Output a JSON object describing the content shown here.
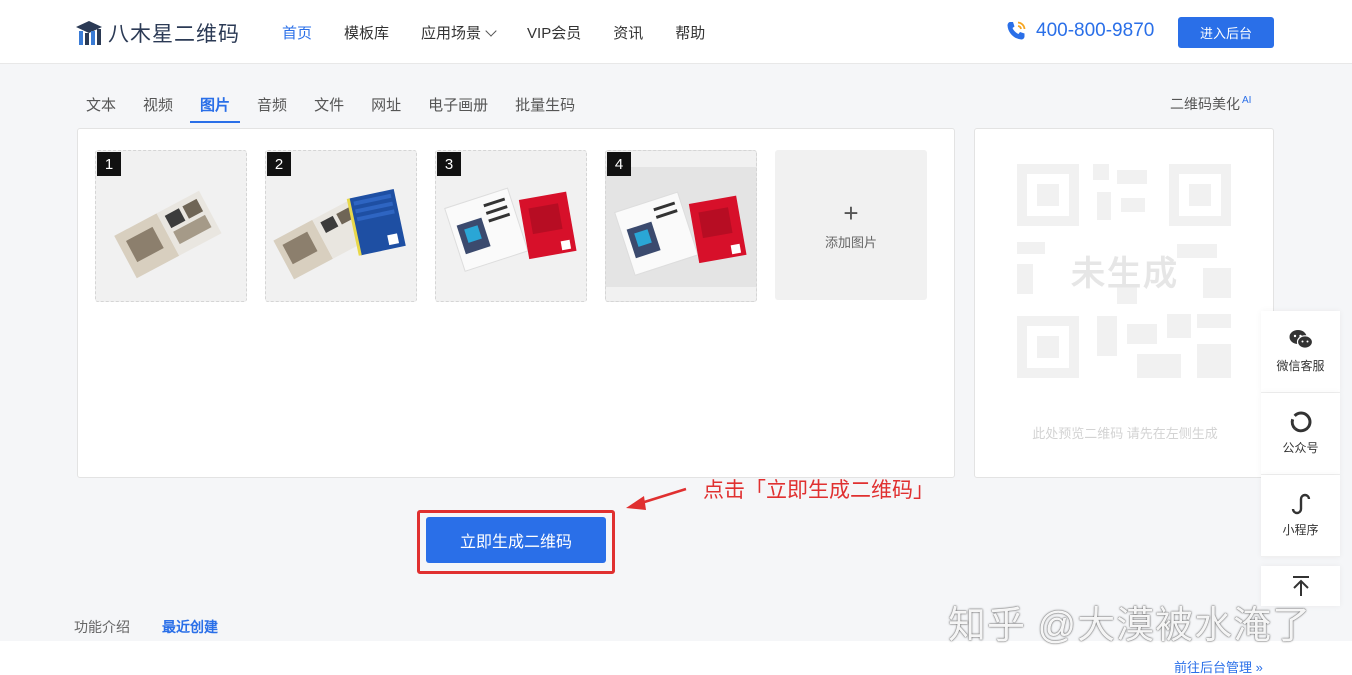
{
  "header": {
    "logo_text": "八木星二维码",
    "nav": [
      {
        "label": "首页",
        "active": true
      },
      {
        "label": "模板库",
        "active": false
      },
      {
        "label": "应用场景",
        "active": false,
        "dropdown": true
      },
      {
        "label": "VIP会员",
        "active": false
      },
      {
        "label": "资讯",
        "active": false
      },
      {
        "label": "帮助",
        "active": false
      }
    ],
    "phone": "400-800-9870",
    "login_label": "进入后台"
  },
  "type_tabs": [
    {
      "label": "文本",
      "active": false
    },
    {
      "label": "视频",
      "active": false
    },
    {
      "label": "图片",
      "active": true
    },
    {
      "label": "音频",
      "active": false
    },
    {
      "label": "文件",
      "active": false
    },
    {
      "label": "网址",
      "active": false
    },
    {
      "label": "电子画册",
      "active": false
    },
    {
      "label": "批量生码",
      "active": false
    }
  ],
  "beautify": {
    "label": "二维码美化",
    "badge": "AI"
  },
  "images": [
    {
      "num": "1"
    },
    {
      "num": "2"
    },
    {
      "num": "3"
    },
    {
      "num": "4"
    }
  ],
  "add_image_label": "添加图片",
  "preview": {
    "status": "未生成",
    "tip": "此处预览二维码 请先在左侧生成"
  },
  "generate_label": "立即生成二维码",
  "annotation": "点击「立即生成二维码」",
  "side_tools": [
    {
      "label": "微信客服",
      "icon": "wechat-icon"
    },
    {
      "label": "公众号",
      "icon": "official-account-icon"
    },
    {
      "label": "小程序",
      "icon": "mini-program-icon"
    }
  ],
  "bottom_tabs": [
    {
      "label": "功能介绍",
      "active": false
    },
    {
      "label": "最近创建",
      "active": true
    }
  ],
  "goto_admin": "前往后台管理 »",
  "watermark": "知乎 @大漠被水淹了",
  "colors": {
    "accent": "#2a6fe8",
    "highlight": "#e03030"
  }
}
